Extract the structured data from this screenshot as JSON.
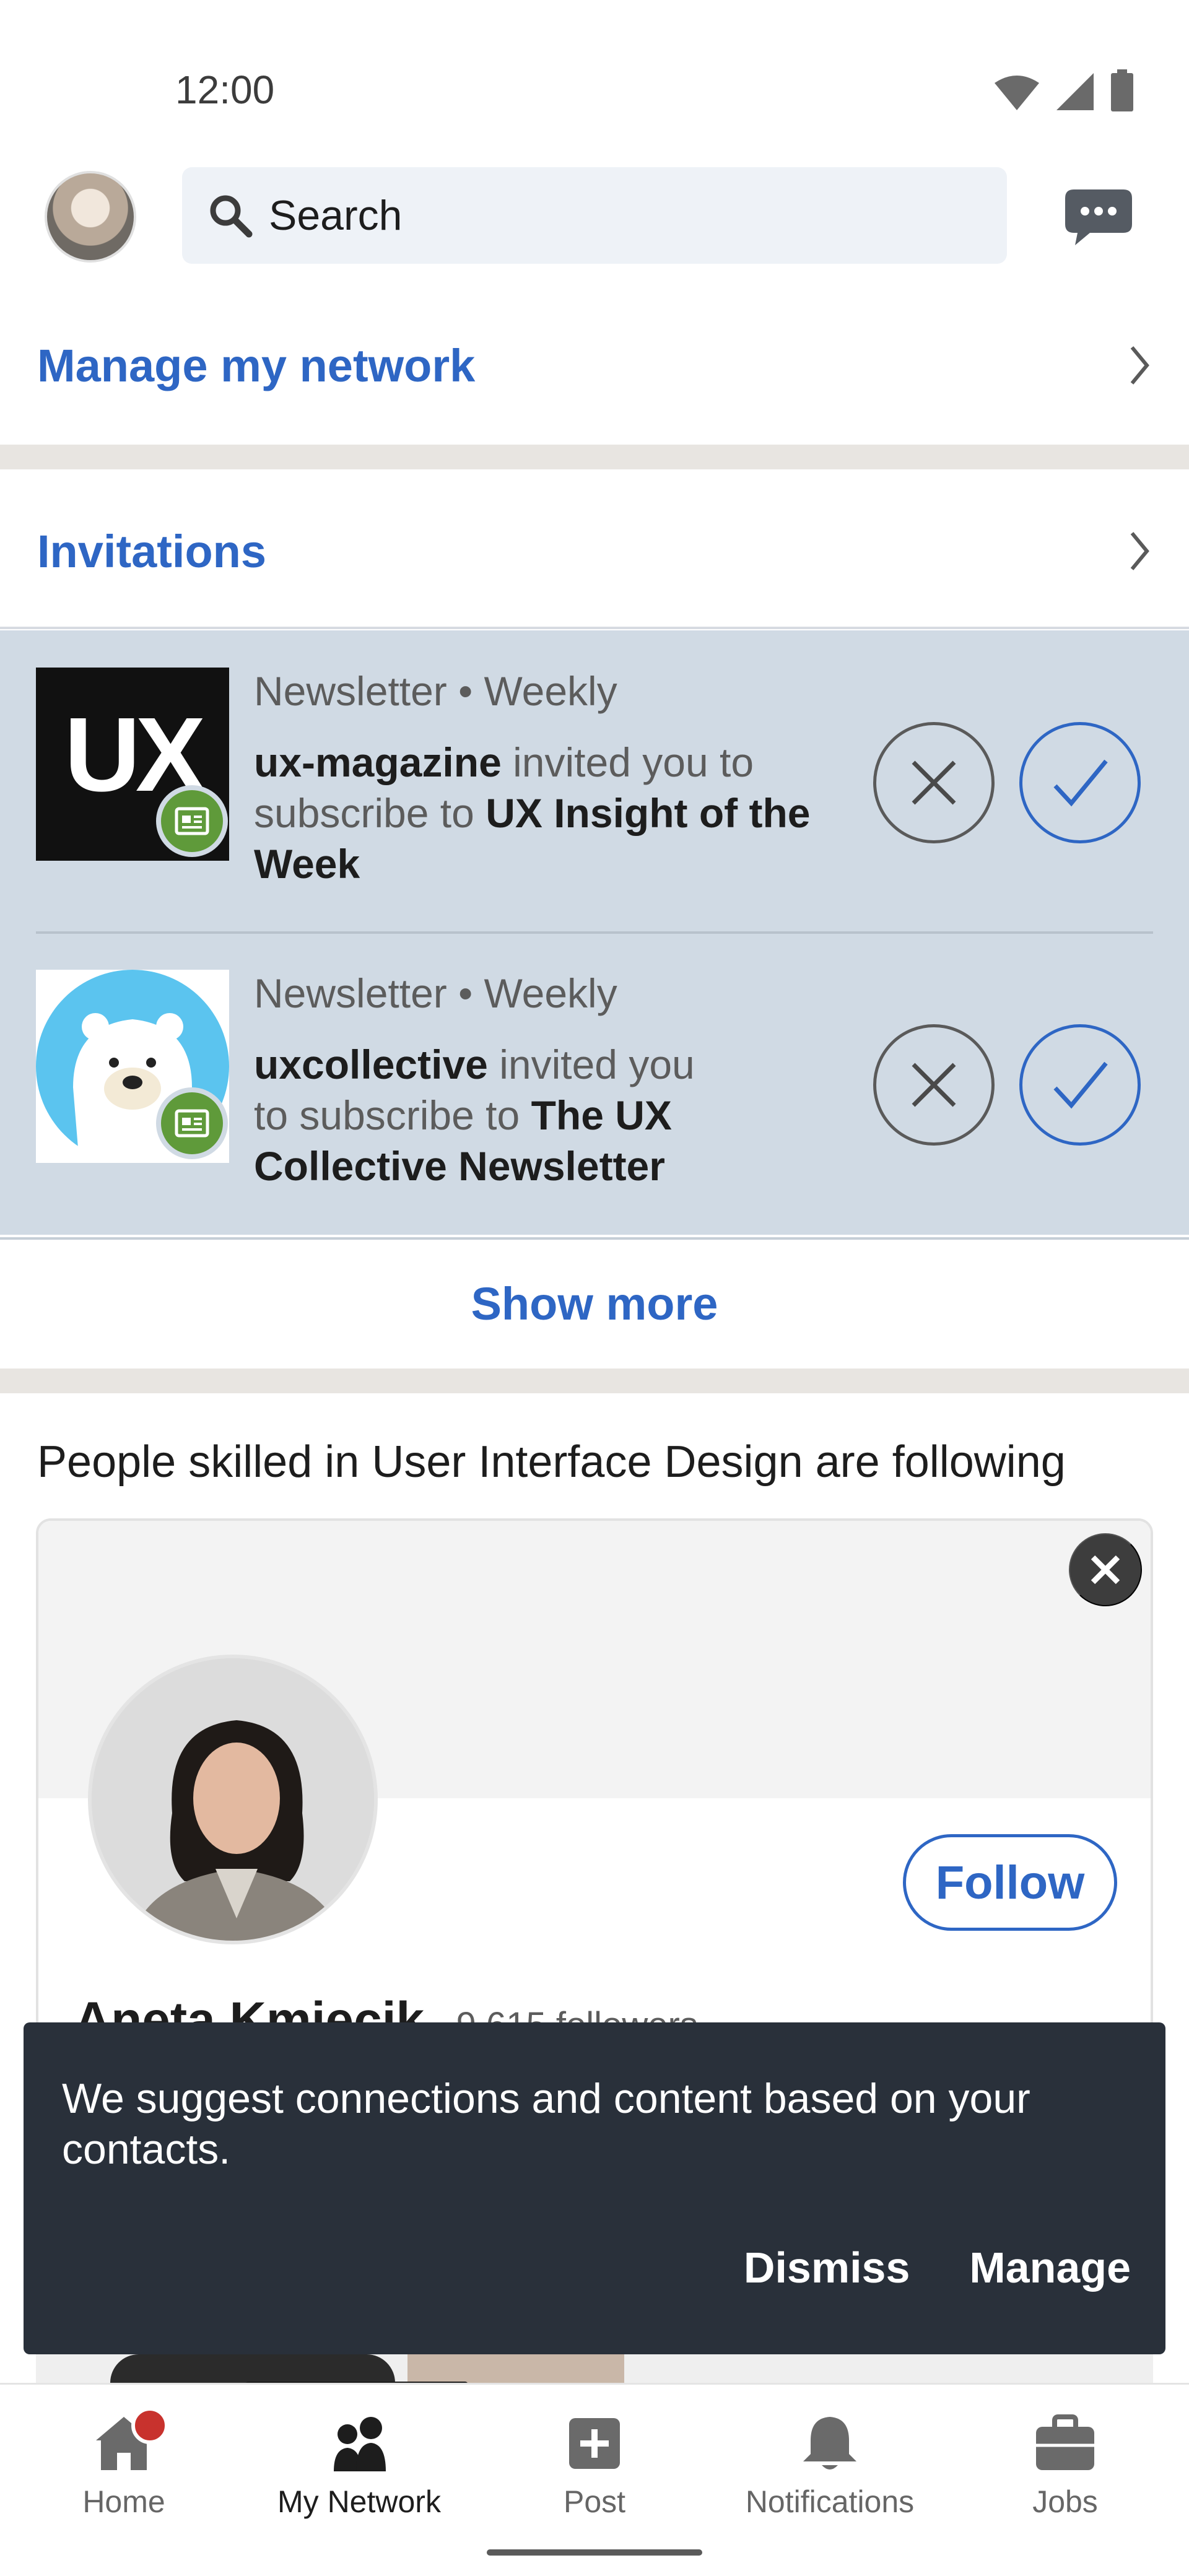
{
  "status_bar": {
    "time": "12:00"
  },
  "top_bar": {
    "search_placeholder": "Search"
  },
  "network": {
    "manage_label": "Manage my network",
    "invitations_label": "Invitations",
    "invites": [
      {
        "meta": "Newsletter • Weekly",
        "sender": "ux-magazine",
        "text": " invited you to subscribe to ",
        "newsletter": "UX Insight of the Week",
        "logo_text": "UX"
      },
      {
        "meta": "Newsletter • Weekly",
        "sender": "uxcollective",
        "text": " invited you to subscribe to ",
        "newsletter": "The UX Collective Newsletter"
      }
    ],
    "show_more": "Show more"
  },
  "suggestions": {
    "section_title": "People skilled in User Interface Design are following",
    "person": {
      "name": "Aneta Kmiecik",
      "followers": " · 9,615 followers",
      "follow_label": "Follow"
    }
  },
  "snackbar": {
    "message": "We suggest connections and content based on your contacts.",
    "dismiss": "Dismiss",
    "manage": "Manage"
  },
  "bottom_nav": {
    "items": [
      {
        "label": "Home",
        "icon": "home-icon"
      },
      {
        "label": "My Network",
        "icon": "network-icon"
      },
      {
        "label": "Post",
        "icon": "post-icon"
      },
      {
        "label": "Notifications",
        "icon": "bell-icon"
      },
      {
        "label": "Jobs",
        "icon": "briefcase-icon"
      }
    ],
    "active": "My Network"
  },
  "colors": {
    "accent_blue": "#2e66c4",
    "invite_bg": "#d0dae4",
    "snackbar_bg": "#29303a",
    "badge_green": "#5f9a3a",
    "notification_red": "#c8322d"
  }
}
